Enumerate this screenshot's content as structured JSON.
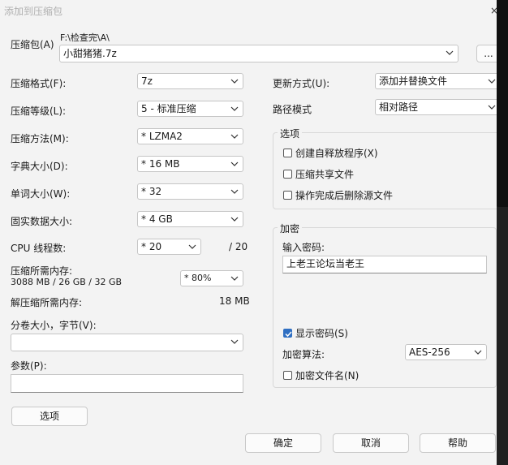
{
  "window": {
    "title": "添加到压缩包",
    "close": "×"
  },
  "archive": {
    "label": "压缩包(A)",
    "path": "F:\\检查完\\A\\",
    "filename": "小甜猪猪.7z",
    "browse": "..."
  },
  "left": {
    "format": {
      "label": "压缩格式(F):",
      "value": "7z"
    },
    "level": {
      "label": "压缩等级(L):",
      "value": "5 - 标准压缩"
    },
    "method": {
      "label": "压缩方法(M):",
      "value": "* LZMA2"
    },
    "dict": {
      "label": "字典大小(D):",
      "value": "* 16 MB"
    },
    "word": {
      "label": "单词大小(W):",
      "value": "* 32"
    },
    "solid": {
      "label": "固实数据大小:",
      "value": "* 4 GB"
    },
    "threads": {
      "label": "CPU 线程数:",
      "value": "* 20",
      "max": "/ 20"
    },
    "mem_compress": {
      "label": "压缩所需内存:",
      "detail": "3088 MB / 26 GB / 32 GB",
      "value": "* 80%"
    },
    "mem_decompress": {
      "label": "解压缩所需内存:",
      "value": "18 MB"
    },
    "split": {
      "label": "分卷大小，字节(V):",
      "value": ""
    },
    "params": {
      "label": "参数(P):",
      "value": ""
    },
    "options_button": "选项"
  },
  "right": {
    "update": {
      "label": "更新方式(U):",
      "value": "添加并替换文件"
    },
    "pathmode": {
      "label": "路径模式",
      "value": "相对路径"
    },
    "options_group": {
      "title": "选项",
      "sfx": "创建自释放程序(X)",
      "shared": "压缩共享文件",
      "delete": "操作完成后删除源文件"
    },
    "encrypt_group": {
      "title": "加密",
      "pw_label": "输入密码:",
      "password": "上老王论坛当老王",
      "show_pw": "显示密码(S)",
      "algo_label": "加密算法:",
      "algo": "AES-256",
      "encrypt_names": "加密文件名(N)"
    }
  },
  "buttons": {
    "ok": "确定",
    "cancel": "取消",
    "help": "帮助"
  },
  "icons": [
    "chevron-down-icon",
    "checkmark-icon",
    "close-icon"
  ]
}
